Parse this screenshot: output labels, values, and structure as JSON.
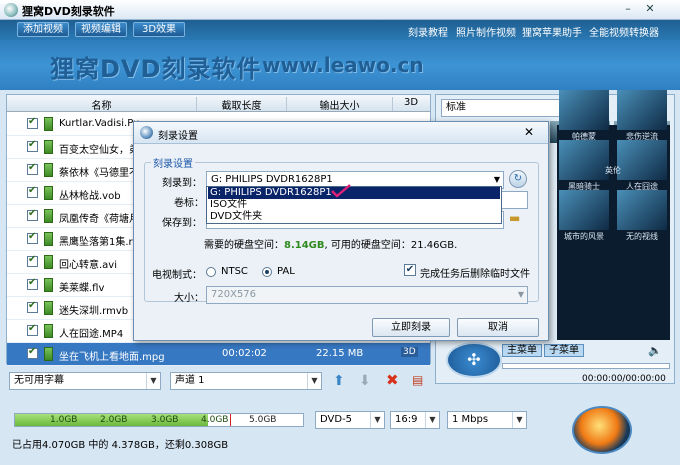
{
  "app": {
    "title": "狸窝DVD刻录软件"
  },
  "menu": {
    "tabs": [
      "添加视频",
      "视频编辑",
      "3D效果"
    ],
    "links": [
      "刻录教程",
      "照片制作视频",
      "狸窝苹果助手",
      "全能视频转换器"
    ]
  },
  "banner": {
    "title": "狸窝DVD刻录软件",
    "url": "www.leawo.cn"
  },
  "file_list": {
    "columns": [
      "名称",
      "截取长度",
      "输出大小",
      "3D"
    ],
    "rows": [
      {
        "name": "Kurtlar.Vadisi.Pus"
      },
      {
        "name": "百变太空仙女，弟"
      },
      {
        "name": "蔡依林《马德里不"
      },
      {
        "name": "丛林枪战.vob"
      },
      {
        "name": "凤凰传奇《荷塘月"
      },
      {
        "name": "黑鹰坠落第1集.rm"
      },
      {
        "name": "回心转意.avi"
      },
      {
        "name": "美莱蝶.flv"
      },
      {
        "name": "迷失深圳.rmvb"
      },
      {
        "name": "人在囧途.MP4"
      },
      {
        "name": "坐在飞机上看地面.mpg",
        "length": "00:02:02",
        "size": "22.15 MB"
      }
    ]
  },
  "controls": {
    "subtitle": "无可用字幕",
    "audio": "声道 1"
  },
  "capacity": {
    "ticks": [
      "1.0GB",
      "2.0GB",
      "3.0GB",
      "4.0GB",
      "5.0GB"
    ],
    "used_fraction": 0.67,
    "status": "已占用4.070GB 中的 4.378GB，还剩0.308GB",
    "disc": "DVD-5",
    "ratio": "16:9",
    "bitrate": "1 Mbps"
  },
  "preview": {
    "template": "标准",
    "menu_tabs": [
      "主菜单",
      "子菜单"
    ],
    "time": "00:00:00/00:00:00",
    "thumb_labels": [
      "英伦",
      "帕德蒙",
      "悲伤逆流",
      "黑暗骑士",
      "人在囧途",
      "城市的风景",
      "无的视线"
    ]
  },
  "dialog": {
    "title": "刻录设置",
    "group": "刻录设置",
    "burn_to_label": "刻录到：",
    "burn_to_value": "G: PHILIPS  DVDR1628P1",
    "volume_label": "卷标：",
    "save_to_label": "保存到：",
    "disk_info_prefix": "需要的硬盘空间：",
    "disk_need": "8.14GB",
    "disk_info_suffix": ", 可用的硬盘空间：21.46GB.",
    "tv_label": "电视制式：",
    "ntsc": "NTSC",
    "pal": "PAL",
    "delete_temp": "完成任务后删除临时文件",
    "size_label": "大小：",
    "size_value": "720X576",
    "burn_button": "立即刻录",
    "cancel_button": "取消",
    "dropdown_options": [
      "G: PHILIPS  DVDR1628P1",
      "ISO文件",
      "DVD文件夹"
    ]
  }
}
